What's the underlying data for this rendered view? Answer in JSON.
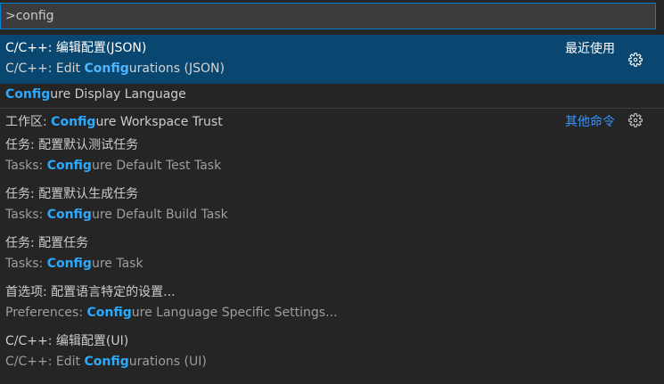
{
  "input": {
    "value": ">config"
  },
  "items": [
    {
      "label_zh": "C/C++: 编辑配置(JSON)",
      "detail_prefix": "C/C++: Edit ",
      "detail_hl": "Config",
      "detail_suffix": "urations (JSON)",
      "right_label": "最近使用",
      "gear_icon": "gear-icon",
      "selected": true
    },
    {
      "label_prefix": "",
      "label_hl": "Config",
      "label_suffix": "ure Display Language"
    },
    {
      "label_prefix": "工作区: ",
      "label_hl": "Config",
      "label_suffix": "ure Workspace Trust",
      "right_label": "其他命令",
      "gear_icon": "gear-icon"
    },
    {
      "label_zh": "任务: 配置默认测试任务",
      "detail_prefix": "Tasks: ",
      "detail_hl": "Config",
      "detail_suffix": "ure Default Test Task"
    },
    {
      "label_zh": "任务: 配置默认生成任务",
      "detail_prefix": "Tasks: ",
      "detail_hl": "Config",
      "detail_suffix": "ure Default Build Task"
    },
    {
      "label_zh": "任务: 配置任务",
      "detail_prefix": "Tasks: ",
      "detail_hl": "Config",
      "detail_suffix": "ure Task"
    },
    {
      "label_zh": "首选项: 配置语言特定的设置...",
      "detail_prefix": "Preferences: ",
      "detail_hl": "Config",
      "detail_suffix": "ure Language Specific Settings..."
    },
    {
      "label_zh": "C/C++: 编辑配置(UI)",
      "detail_prefix": "C/C++: Edit ",
      "detail_hl": "Config",
      "detail_suffix": "urations (UI)"
    }
  ],
  "colors": {
    "background": "#252526",
    "selected": "#094771",
    "highlight": "#2aaaff",
    "link": "#3794ff",
    "focus_border": "#007fd4"
  }
}
